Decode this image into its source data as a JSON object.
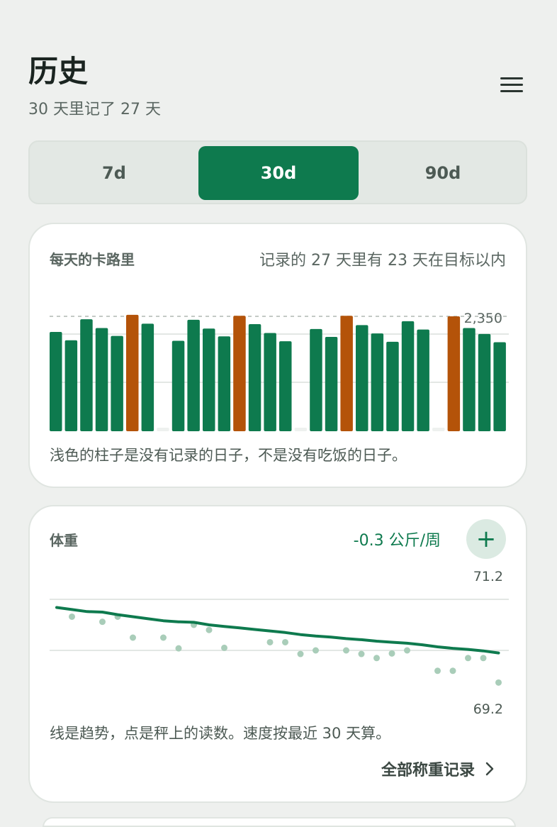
{
  "header": {
    "title": "历史",
    "subtitle": "30 天里记了 27 天"
  },
  "icons": {
    "menu": "hamburger-menu-icon",
    "add": "plus-icon",
    "chevron": "chevron-right-icon"
  },
  "colors": {
    "accent": "#0e7a4e",
    "over_goal": "#b45309",
    "missing_day": "#eef1ef",
    "weight_point": "#a9cdb9",
    "background": "#eef0ee"
  },
  "range_tabs": [
    {
      "label": "7d",
      "selected": false
    },
    {
      "label": "30d",
      "selected": true
    },
    {
      "label": "90d",
      "selected": false
    }
  ],
  "calories_card": {
    "title": "每天的卡路里",
    "summary": "记录的 27 天里有 23 天在目标以内",
    "goal_label": "2,350",
    "note": "浅色的柱子是没有记录的日子，不是没有吃饭的日子。"
  },
  "weight_card": {
    "title": "体重",
    "rate": "-0.3 公斤/周",
    "max_label": "71.2",
    "min_label": "69.2",
    "note": "线是趋势，点是秤上的读数。速度按最近 30 天算。",
    "all_link": "全部称重记录"
  },
  "chart_data": [
    {
      "type": "bar",
      "title": "每天的卡路里",
      "goal": 2350,
      "ylim": [
        0,
        2700
      ],
      "grid": true,
      "values": [
        2030,
        1860,
        2290,
        2110,
        1950,
        2380,
        2200,
        0,
        1850,
        2280,
        2100,
        1940,
        2360,
        2190,
        2010,
        1840,
        0,
        2090,
        1930,
        2360,
        2170,
        2000,
        1830,
        2250,
        2080,
        0,
        2350,
        2110,
        1990,
        1820
      ],
      "status": [
        "ok",
        "ok",
        "ok",
        "ok",
        "ok",
        "over",
        "ok",
        "missing",
        "ok",
        "ok",
        "ok",
        "ok",
        "over",
        "ok",
        "ok",
        "ok",
        "missing",
        "ok",
        "ok",
        "over",
        "ok",
        "ok",
        "ok",
        "ok",
        "ok",
        "missing",
        "over",
        "ok",
        "ok",
        "ok"
      ]
    },
    {
      "type": "line",
      "title": "体重",
      "ylim": [
        69.2,
        71.2
      ],
      "series": [
        {
          "role": "trend",
          "values": [
            71.04,
            71.0,
            70.96,
            70.95,
            70.9,
            70.86,
            70.82,
            70.78,
            70.76,
            70.75,
            70.7,
            70.67,
            70.64,
            70.61,
            70.58,
            70.55,
            70.51,
            70.48,
            70.46,
            70.43,
            70.41,
            70.38,
            70.36,
            70.34,
            70.31,
            70.27,
            70.24,
            70.22,
            70.19,
            70.15
          ]
        },
        {
          "role": "readings",
          "days": [
            1,
            3,
            4,
            5,
            7,
            8,
            9,
            10,
            11,
            14,
            15,
            16,
            17,
            19,
            20,
            21,
            22,
            23,
            25,
            26,
            27,
            28,
            29
          ],
          "values": [
            70.86,
            70.76,
            70.86,
            70.45,
            70.45,
            70.24,
            70.7,
            70.6,
            70.25,
            70.36,
            70.36,
            70.13,
            70.2,
            70.2,
            70.13,
            70.05,
            70.14,
            70.2,
            69.8,
            69.8,
            70.05,
            70.05,
            69.57
          ]
        }
      ]
    }
  ]
}
